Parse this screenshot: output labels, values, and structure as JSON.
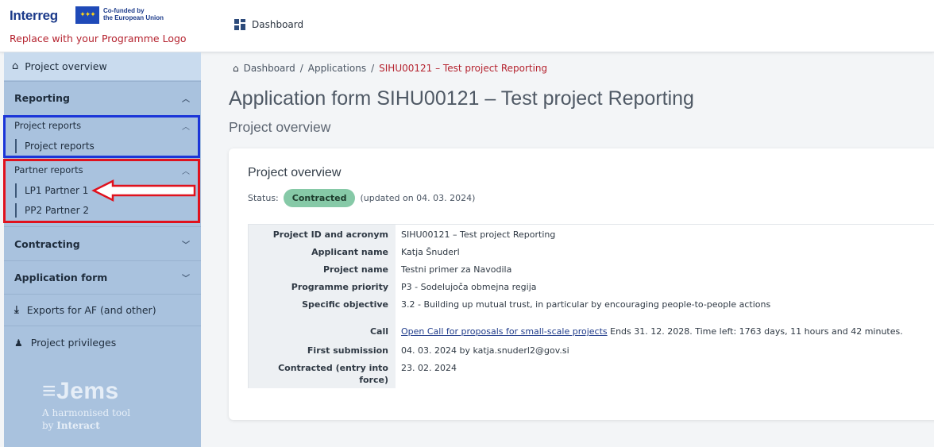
{
  "header": {
    "logo_brand": "Interreg",
    "eu_line1": "Co-funded by",
    "eu_line2": "the European Union",
    "logo_placeholder": "Replace with your Programme Logo",
    "dashboard_label": "Dashboard"
  },
  "sidebar": {
    "project_overview": "Project overview",
    "reporting": "Reporting",
    "project_reports_header": "Project reports",
    "project_reports_item": "Project reports",
    "partner_reports_header": "Partner reports",
    "partner_items": [
      "LP1 Partner 1",
      "PP2 Partner 2"
    ],
    "contracting": "Contracting",
    "application_form": "Application form",
    "exports": "Exports for AF (and other)",
    "privileges": "Project privileges",
    "jems_logo": "Jems",
    "jems_tagline1": "A harmonised tool",
    "jems_tagline2_prefix": "by ",
    "jems_tagline2_brand": "Interact"
  },
  "breadcrumb": {
    "items": [
      "Dashboard",
      "Applications"
    ],
    "current": "SIHU00121 – Test project Reporting",
    "separator": "/"
  },
  "page": {
    "title": "Application form SIHU00121 – Test project Reporting",
    "subtitle": "Project overview"
  },
  "card": {
    "title": "Project overview",
    "status_label": "Status:",
    "status_value": "Contracted",
    "status_updated": "(updated on 04. 03. 2024)",
    "rows": [
      {
        "label": "Project ID and acronym",
        "value": "SIHU00121 – Test project Reporting"
      },
      {
        "label": "Applicant name",
        "value": "Katja Šnuderl"
      },
      {
        "label": "Project name",
        "value": "Testni primer za Navodila"
      },
      {
        "label": "Programme priority",
        "value": "P3 - Sodelujoča obmejna regija"
      },
      {
        "label": "Specific objective",
        "value": "3.2 - Building up mutual trust, in particular by encouraging people-to-people actions"
      },
      {
        "label": "Call",
        "link": "Open Call for proposals for small-scale projects",
        "value": " Ends 31. 12. 2028. Time left: 1763 days, 11 hours and 42 minutes."
      },
      {
        "label": "First submission",
        "value": "04. 03. 2024 by katja.snuderl2@gov.si"
      },
      {
        "label": "Contracted (entry into force)",
        "value": "23. 02. 2024"
      }
    ]
  },
  "colors": {
    "sidebar_bg": "#a9c2de",
    "active_bg": "#c9dbee",
    "status_green": "#86c9a7",
    "breadcrumb_current": "#b5232f",
    "annotation_blue": "#1b35d8",
    "annotation_red": "#e0111d"
  },
  "icons": [
    "home-icon",
    "grid-icon",
    "chevron-up-icon",
    "chevron-down-icon",
    "download-icon",
    "users-icon",
    "eu-flag-icon"
  ]
}
